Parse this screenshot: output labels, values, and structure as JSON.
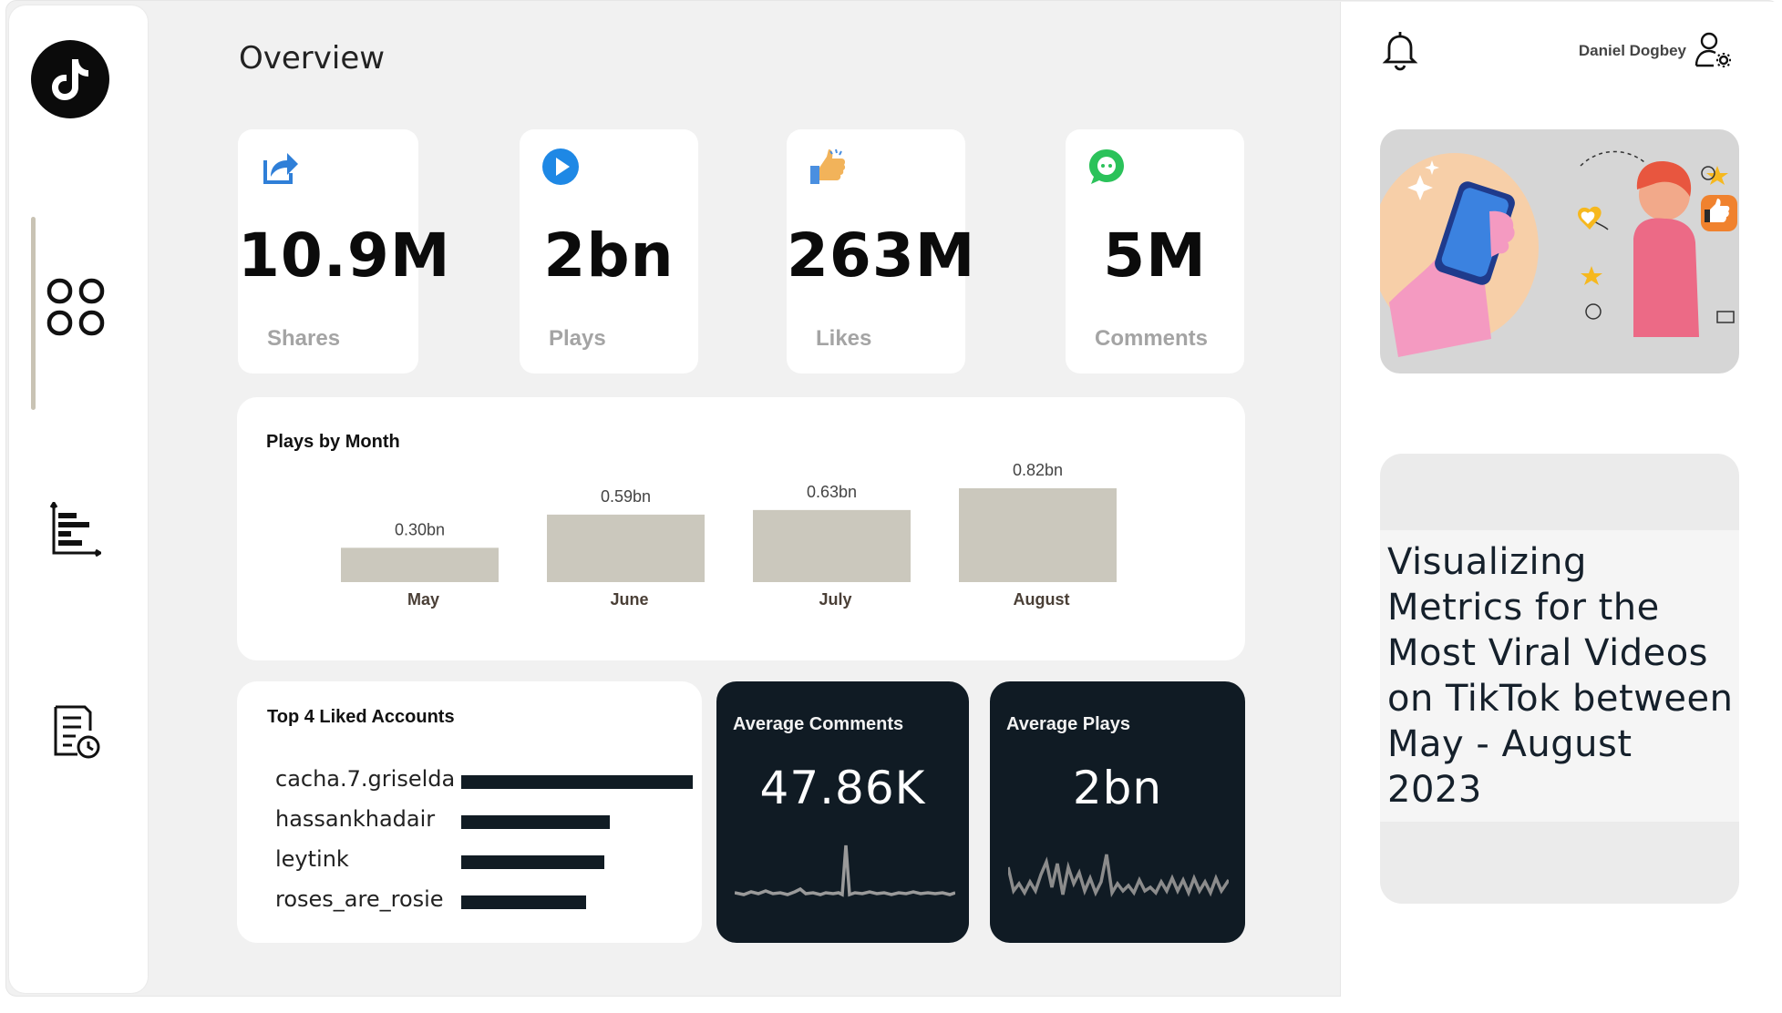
{
  "header": {
    "title": "Overview"
  },
  "user": {
    "name": "Daniel Dogbey"
  },
  "stats": [
    {
      "value": "10.9M",
      "label": "Shares",
      "icon": "share-icon",
      "accent": "#2f7fd8"
    },
    {
      "value": "2bn",
      "label": "Plays",
      "icon": "play-icon",
      "accent": "#1e88e5"
    },
    {
      "value": "263M",
      "label": "Likes",
      "icon": "thumbs-up-icon",
      "accent": "#f2b35a"
    },
    {
      "value": "5M",
      "label": "Comments",
      "icon": "chat-icon",
      "accent": "#2bc25a"
    }
  ],
  "plays_chart": {
    "title": "Plays by Month",
    "bar_color": "#cbc8bd"
  },
  "accounts": {
    "title": "Top 4 Liked Accounts",
    "bar_color": "#111c24"
  },
  "avg_comments": {
    "title": "Average Comments",
    "value": "47.86K"
  },
  "avg_plays": {
    "title": "Average Plays",
    "value": "2bn"
  },
  "side": {
    "headline": "Visualizing Metrics for the Most Viral Videos on TikTok between May - August 2023"
  },
  "chart_data": [
    {
      "type": "bar",
      "title": "Plays by Month",
      "categories": [
        "May",
        "June",
        "July",
        "August"
      ],
      "values": [
        0.3,
        0.59,
        0.63,
        0.82
      ],
      "data_labels": [
        "0.30bn",
        "0.59bn",
        "0.63bn",
        "0.82bn"
      ],
      "ylim": [
        0,
        0.82
      ],
      "grid": false
    },
    {
      "type": "bar",
      "title": "Top 4 Liked Accounts",
      "orientation": "horizontal",
      "categories": [
        "cacha.7.griselda",
        "hassankhadair",
        "leytink",
        "roses_are_rosie"
      ],
      "values": [
        1.0,
        0.64,
        0.62,
        0.54
      ]
    }
  ]
}
